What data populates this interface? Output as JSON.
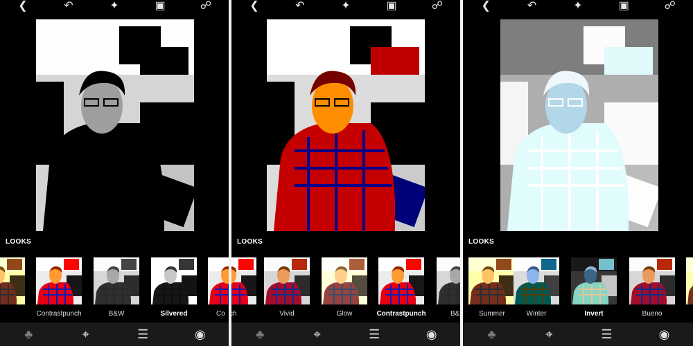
{
  "panels": [
    {
      "name": "left",
      "filter": "silvered",
      "looks_label": "LOOKS",
      "thumbs": [
        {
          "label": "ew",
          "filter": "warm"
        },
        {
          "label": "Contrastpunch",
          "filter": "contrast"
        },
        {
          "label": "B&W",
          "filter": "bw"
        },
        {
          "label": "Silvered",
          "filter": "silvered",
          "selected": true
        },
        {
          "label": "Co",
          "filter": "contrast"
        }
      ]
    },
    {
      "name": "middle",
      "filter": "contrast",
      "looks_label": "LOOKS",
      "thumbs": [
        {
          "label": "punch",
          "filter": "contrast"
        },
        {
          "label": "Vivid",
          "filter": "vivid"
        },
        {
          "label": "Glow",
          "filter": "glow"
        },
        {
          "label": "Contrastpunch",
          "filter": "contrast",
          "selected": true
        },
        {
          "label": "B&",
          "filter": "bw"
        }
      ]
    },
    {
      "name": "right",
      "filter": "invert",
      "looks_label": "LOOKS",
      "thumbs": [
        {
          "label": "Summer",
          "filter": "warm"
        },
        {
          "label": "Winter",
          "filter": "cool"
        },
        {
          "label": "Invert",
          "filter": "invert",
          "selected": true
        },
        {
          "label": "Bueno",
          "filter": "vivid"
        },
        {
          "label": "",
          "filter": "warm"
        }
      ]
    }
  ],
  "icons": {
    "top": [
      "back-icon",
      "undo-icon",
      "magic-wand-icon",
      "image-icon",
      "share-icon"
    ],
    "bottom": [
      "looks-icon",
      "crop-icon",
      "tune-icon",
      "preview-icon"
    ]
  },
  "colors": {
    "background": "#000000",
    "divider": "#f2f2f2",
    "bottom_bar": "#1a1a1a"
  }
}
